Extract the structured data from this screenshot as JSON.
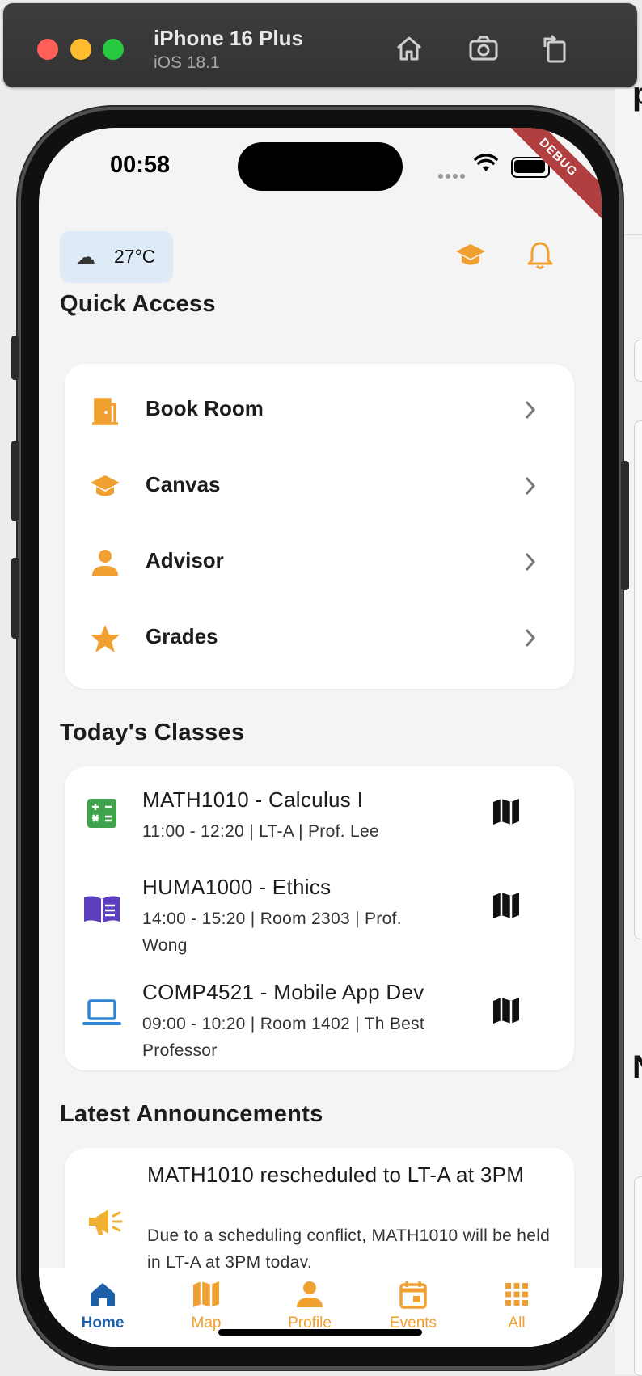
{
  "simulator": {
    "device": "iPhone 16 Plus",
    "os": "iOS 18.1",
    "icons": [
      "home-icon",
      "screenshot-icon",
      "rotate-icon"
    ]
  },
  "status_bar": {
    "time": "00:58",
    "debug_banner": "DEBUG"
  },
  "header": {
    "weather_icon": "cloud-icon",
    "temperature": "27°C",
    "icons": [
      "graduation-cap-icon",
      "bell-icon"
    ]
  },
  "quick_access": {
    "title": "Quick Access",
    "items": [
      {
        "label": "Book Room",
        "icon": "door-icon"
      },
      {
        "label": "Canvas",
        "icon": "graduation-cap-icon"
      },
      {
        "label": "Advisor",
        "icon": "person-icon"
      },
      {
        "label": "Grades",
        "icon": "star-icon"
      }
    ]
  },
  "todays_classes": {
    "title": "Today's Classes",
    "items": [
      {
        "title": "MATH1010 - Calculus I",
        "details": "11:00 - 12:20 | LT-A | Prof. Lee",
        "icon": "calculator-icon",
        "icon_color": "#3fa34d"
      },
      {
        "title": "HUMA1000 - Ethics",
        "details": "14:00 - 15:20 | Room 2303 | Prof. Wong",
        "icon": "book-icon",
        "icon_color": "#5b3fbf"
      },
      {
        "title": "COMP4521 - Mobile App Dev",
        "details": "09:00 - 10:20 | Room 1402 | Th Best Professor",
        "icon": "laptop-icon",
        "icon_color": "#2f86d6"
      }
    ]
  },
  "announcements": {
    "title": "Latest Announcements",
    "items": [
      {
        "title": "MATH1010 rescheduled to LT-A at 3PM",
        "body": "Due to a scheduling conflict, MATH1010 will be held in LT-A at 3PM today.",
        "icon": "megaphone-icon"
      }
    ]
  },
  "bottom_nav": {
    "items": [
      {
        "label": "Home",
        "icon": "home-icon",
        "active": true
      },
      {
        "label": "Map",
        "icon": "map-icon",
        "active": false
      },
      {
        "label": "Profile",
        "icon": "person-icon",
        "active": false
      },
      {
        "label": "Events",
        "icon": "calendar-icon",
        "active": false
      },
      {
        "label": "All",
        "icon": "apps-grid-icon",
        "active": false
      }
    ]
  },
  "colors": {
    "accent": "#f0a030",
    "active_nav": "#1f5fa8",
    "background": "#f4f4f4"
  }
}
